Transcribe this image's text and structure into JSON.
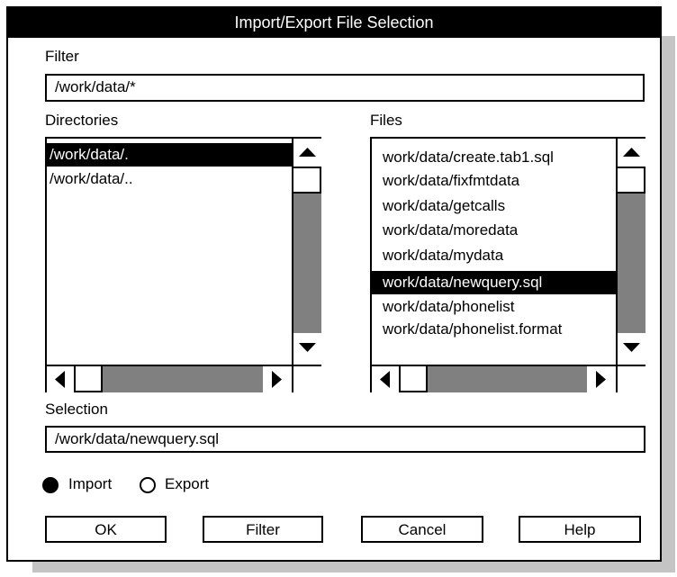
{
  "dialog": {
    "title": "Import/Export File Selection"
  },
  "filter": {
    "label": "Filter",
    "value": "/work/data/*"
  },
  "directories": {
    "label": "Directories",
    "items": [
      "/work/data/.",
      "/work/data/.."
    ],
    "selected_index": 0
  },
  "files": {
    "label": "Files",
    "items": [
      "work/data/create.tab1.sql",
      "work/data/fixfmtdata",
      "work/data/getcalls",
      "work/data/moredata",
      "work/data/mydata",
      "work/data/newquery.sql",
      "work/data/phonelist",
      "work/data/phonelist.format"
    ],
    "selected_index": 5
  },
  "selection": {
    "label": "Selection",
    "value": "/work/data/newquery.sql"
  },
  "mode": {
    "options": [
      "Import",
      "Export"
    ],
    "selected": "Import"
  },
  "buttons": {
    "ok": "OK",
    "filter": "Filter",
    "cancel": "Cancel",
    "help": "Help"
  },
  "icons": {
    "up": "up-arrow-icon",
    "down": "down-arrow-icon",
    "left": "left-arrow-icon",
    "right": "right-arrow-icon"
  }
}
